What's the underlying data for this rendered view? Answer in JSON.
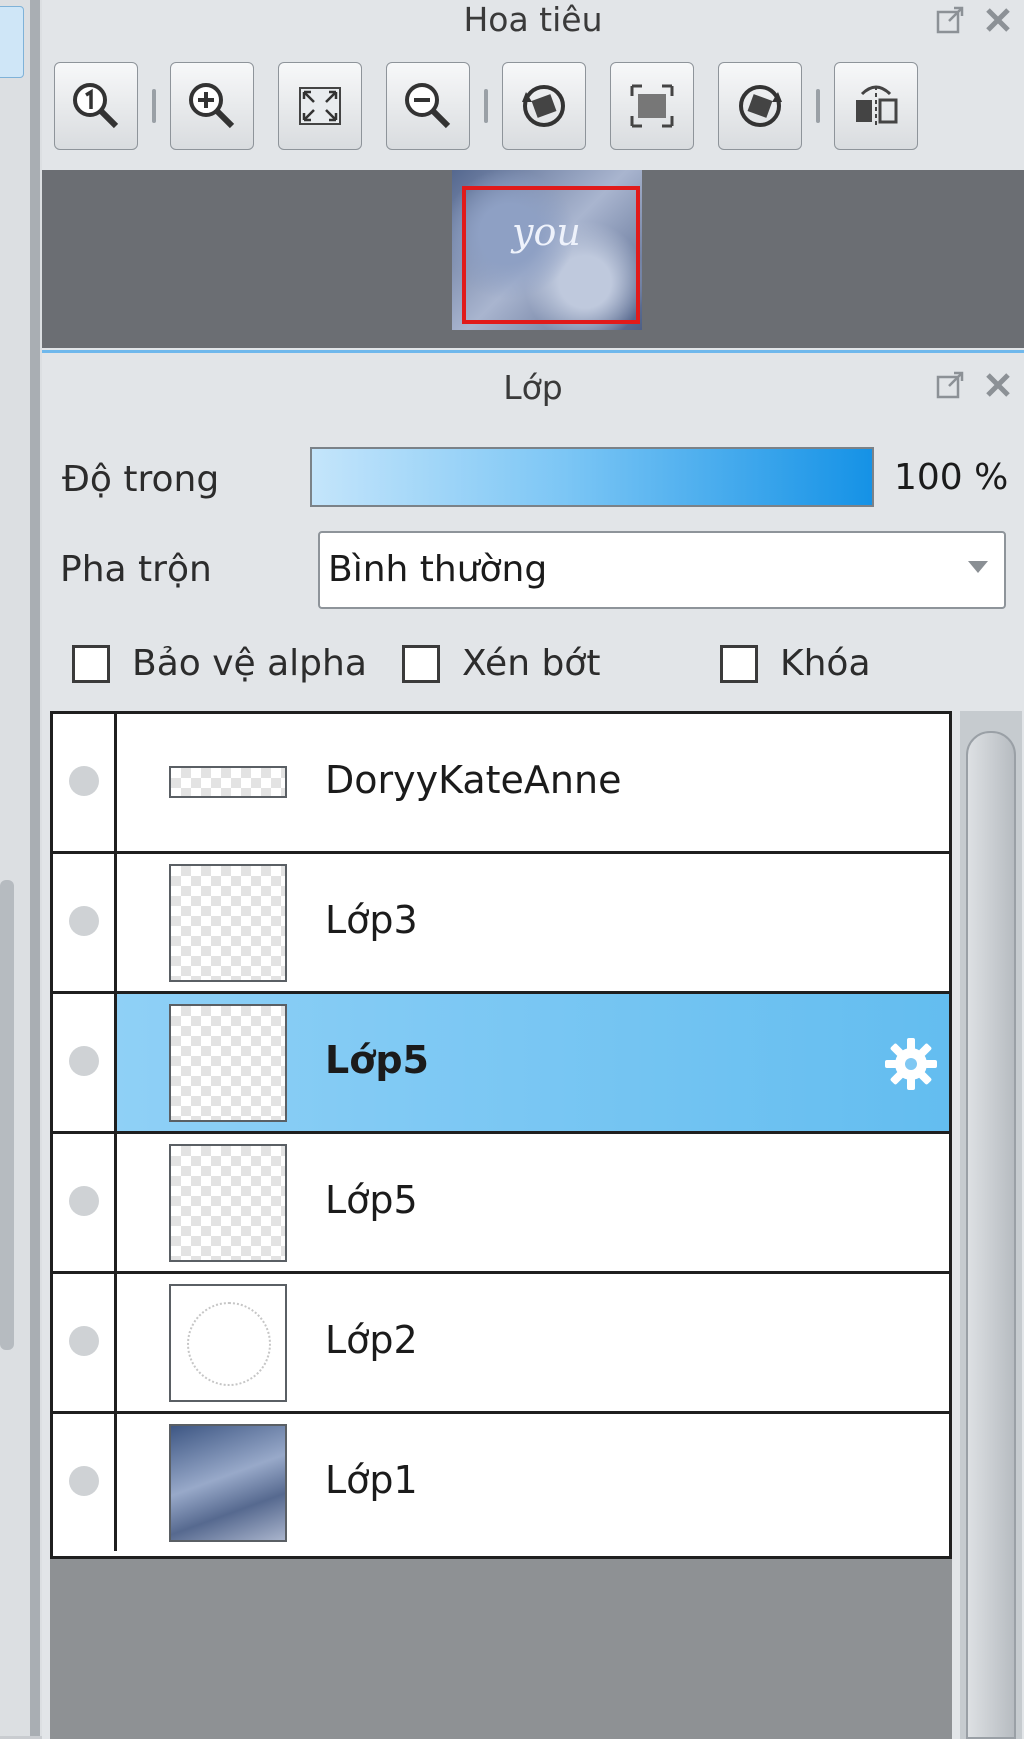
{
  "navigator": {
    "title": "Hoa tiêu",
    "toolbar": [
      {
        "icon": "zoom-actual-icon"
      },
      {
        "icon": "zoom-in-icon"
      },
      {
        "icon": "fit-screen-icon"
      },
      {
        "icon": "zoom-out-icon"
      },
      {
        "icon": "rotate-left-icon"
      },
      {
        "icon": "reset-view-icon"
      },
      {
        "icon": "rotate-right-icon"
      },
      {
        "icon": "flip-horizontal-icon"
      }
    ],
    "preview_word": "you"
  },
  "layers_panel": {
    "title": "Lớp",
    "opacity_label": "Độ trong",
    "opacity_value": "100 %",
    "opacity_fraction": 1.0,
    "blend_label": "Pha trộn",
    "blend_value": "Bình thường",
    "checkboxes": [
      {
        "label": "Bảo vệ alpha",
        "checked": false
      },
      {
        "label": "Xén bớt",
        "checked": false
      },
      {
        "label": "Khóa",
        "checked": false
      }
    ],
    "layers": [
      {
        "name": "DoryyKateAnne",
        "selected": false
      },
      {
        "name": "Lớp3",
        "selected": false
      },
      {
        "name": "Lớp5",
        "selected": true
      },
      {
        "name": "Lớp5",
        "selected": false
      },
      {
        "name": "Lớp2",
        "selected": false
      },
      {
        "name": "Lớp1",
        "selected": false
      }
    ]
  },
  "colors": {
    "accent": "#1592e6",
    "selection": "#63bdf0",
    "navigator_frame": "#e11a1a"
  }
}
